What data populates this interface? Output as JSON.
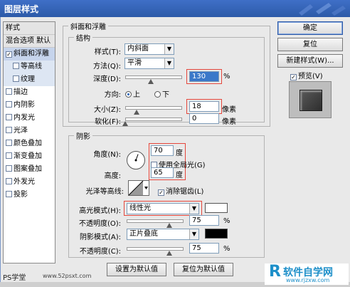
{
  "window": {
    "title": "图层样式"
  },
  "styles_panel": {
    "header_styles": "样式",
    "header_blend": "混合选项 默认",
    "items": [
      {
        "label": "斜面和浮雕",
        "checked": true,
        "selected": true,
        "sub": false
      },
      {
        "label": "等高线",
        "checked": false,
        "selected": false,
        "sub": true
      },
      {
        "label": "纹理",
        "checked": false,
        "selected": false,
        "sub": true
      },
      {
        "label": "描边",
        "checked": false,
        "selected": false,
        "sub": false
      },
      {
        "label": "内阴影",
        "checked": false,
        "selected": false,
        "sub": false
      },
      {
        "label": "内发光",
        "checked": false,
        "selected": false,
        "sub": false
      },
      {
        "label": "光泽",
        "checked": false,
        "selected": false,
        "sub": false
      },
      {
        "label": "颜色叠加",
        "checked": false,
        "selected": false,
        "sub": false
      },
      {
        "label": "渐变叠加",
        "checked": false,
        "selected": false,
        "sub": false
      },
      {
        "label": "图案叠加",
        "checked": false,
        "selected": false,
        "sub": false
      },
      {
        "label": "外发光",
        "checked": false,
        "selected": false,
        "sub": false
      },
      {
        "label": "投影",
        "checked": false,
        "selected": false,
        "sub": false
      }
    ],
    "check_mark": "✓"
  },
  "bevel": {
    "section_title": "斜面和浮雕",
    "structure_title": "结构",
    "style_label": "样式(T):",
    "style_value": "内斜面",
    "technique_label": "方法(Q):",
    "technique_value": "平滑",
    "depth_label": "深度(D):",
    "depth_value": "130",
    "depth_level_pct": 45,
    "percent": "%",
    "direction_label": "方向:",
    "direction_up": "上",
    "direction_down": "下",
    "direction_selected": "up",
    "size_label": "大小(Z):",
    "size_value": "18",
    "size_level_pct": 20,
    "pixels": "像素",
    "soften_label": "软化(F):",
    "soften_value": "0",
    "soften_level_pct": 0
  },
  "shading": {
    "title": "阴影",
    "angle_label": "角度(N):",
    "angle_value": "70",
    "degree": "度",
    "global_light_label": "使用全局光(G)",
    "global_light_checked": false,
    "altitude_label": "高度:",
    "altitude_value": "65",
    "gloss_contour_label": "光泽等高线:",
    "anti_aliased_label": "消除锯齿(L)",
    "anti_aliased_checked": true,
    "highlight_mode_label": "高光模式(H):",
    "highlight_mode_value": "线性光",
    "highlight_color": "#ffffff",
    "highlight_opacity_label": "不透明度(O):",
    "highlight_opacity_value": "75",
    "highlight_opacity_level_pct": 75,
    "shadow_mode_label": "阴影模式(A):",
    "shadow_mode_value": "正片叠底",
    "shadow_color": "#000000",
    "shadow_opacity_label": "不透明度(C):",
    "shadow_opacity_value": "75",
    "shadow_opacity_level_pct": 75
  },
  "bottom_buttons": {
    "make_default": "设置为默认值",
    "reset_default": "复位为默认值"
  },
  "right_panel": {
    "ok": "确定",
    "reset": "复位",
    "new_style": "新建样式(W)...",
    "preview_label": "预览(V)",
    "preview_checked": true
  },
  "watermark": {
    "left": "PS学堂",
    "middle": "www.52psxt.com",
    "right_text": "软件自学网",
    "right_url": "www.rjzxw.com"
  },
  "colors": {
    "highlight_red": "#e5463b",
    "title_blue": "#2c5aa8",
    "selection": "#c6d4ec"
  }
}
